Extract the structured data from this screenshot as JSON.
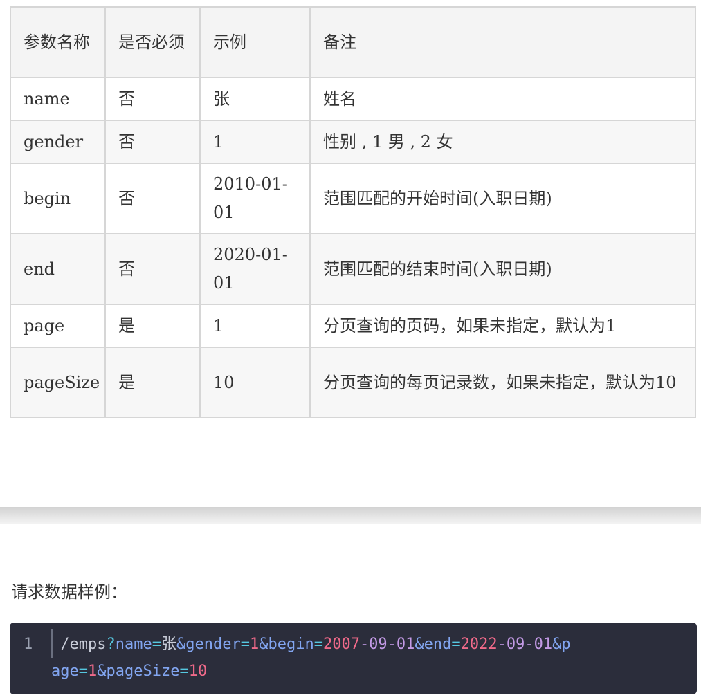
{
  "table": {
    "headers": [
      "参数名称",
      "是否必须",
      "示例",
      "备注"
    ],
    "rows": [
      {
        "name": "name",
        "required": "否",
        "example": "张",
        "note": "姓名"
      },
      {
        "name": "gender",
        "required": "否",
        "example": "1",
        "note": "性别 , 1 男 , 2 女"
      },
      {
        "name": "begin",
        "required": "否",
        "example": "2010-01-01",
        "note": "范围匹配的开始时间(入职日期)"
      },
      {
        "name": "end",
        "required": "否",
        "example": "2020-01-01",
        "note": "范围匹配的结束时间(入职日期)"
      },
      {
        "name": "page",
        "required": "是",
        "example": "1",
        "note": "分页查询的页码，如果未指定，默认为1"
      },
      {
        "name": "pageSize",
        "required": "是",
        "example": "10",
        "note": "分页查询的每页记录数，如果未指定，默认为10"
      }
    ]
  },
  "request_label": "请求数据样例：",
  "code": {
    "line_number": "1",
    "tokens": [
      {
        "text": " ",
        "kind": "plain"
      },
      {
        "text": "/emps",
        "kind": "plain"
      },
      {
        "text": "?",
        "kind": "op"
      },
      {
        "text": "name",
        "kind": "key"
      },
      {
        "text": "=",
        "kind": "op"
      },
      {
        "text": "张",
        "kind": "plain"
      },
      {
        "text": "&",
        "kind": "key"
      },
      {
        "text": "gender",
        "kind": "key"
      },
      {
        "text": "=",
        "kind": "op"
      },
      {
        "text": "1",
        "kind": "num"
      },
      {
        "text": "&",
        "kind": "key"
      },
      {
        "text": "begin",
        "kind": "key"
      },
      {
        "text": "=",
        "kind": "op"
      },
      {
        "text": "2007",
        "kind": "num"
      },
      {
        "text": "-09-01",
        "kind": "str"
      },
      {
        "text": "&",
        "kind": "key"
      },
      {
        "text": "end",
        "kind": "key"
      },
      {
        "text": "=",
        "kind": "op"
      },
      {
        "text": "2022",
        "kind": "num"
      },
      {
        "text": "-09-01",
        "kind": "str"
      },
      {
        "text": "&",
        "kind": "key"
      },
      {
        "text": "page",
        "kind": "key"
      },
      {
        "text": "=",
        "kind": "op"
      },
      {
        "text": "1",
        "kind": "num"
      },
      {
        "text": "&",
        "kind": "key"
      },
      {
        "text": "pageSize",
        "kind": "key"
      },
      {
        "text": "=",
        "kind": "op"
      },
      {
        "text": "10",
        "kind": "num"
      }
    ]
  }
}
